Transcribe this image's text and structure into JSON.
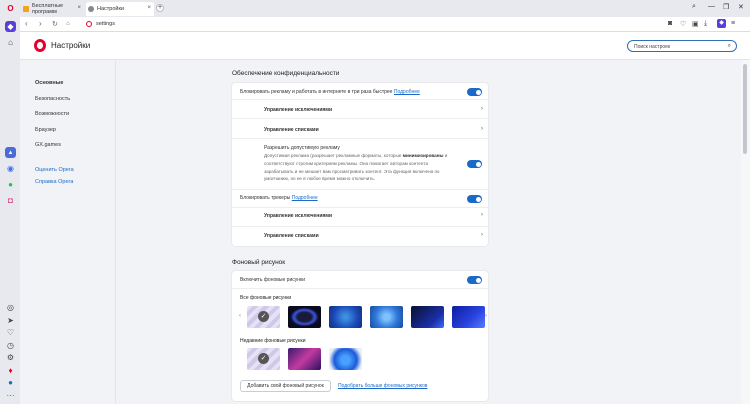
{
  "tabs": [
    {
      "label": "Бесплатные программ"
    },
    {
      "label": "Настройки"
    }
  ],
  "window": {
    "minimize": "—",
    "restore": "❐",
    "close": "✕"
  },
  "address": {
    "url": "settings"
  },
  "header": {
    "title": "Настройки",
    "search_placeholder": "Поиск настроек"
  },
  "leftnav": {
    "items": [
      "Основные",
      "Безопасность",
      "Возможности",
      "Браузер",
      "GX.games"
    ],
    "links": [
      "Оценить Opera",
      "Справка Opera"
    ]
  },
  "privacy": {
    "title": "Обеспечение конфиденциальности",
    "adblock_label": "Блокировать рекламу и работать в интернете в три раза быстрее",
    "more": "Подробнее",
    "exceptions": "Управление исключениями",
    "lists": "Управление списками",
    "acceptable_title": "Разрешить допустимую рекламу",
    "acceptable_desc_1": "Допустимая реклама (разрешает рекламные форматы, которые",
    "acceptable_bold": "минимизированы",
    "acceptable_desc_2": "и соответствуют строгим критериям рекламы. Она помогает авторам контента зарабатывать и не мешает вам просматривать контент. Эта функция включена по умолчанию, но ее в любое время можно отключить.",
    "trackers_label": "Блокировать трекеры",
    "trackers_more": "Подробнее",
    "exceptions2": "Управление исключениями",
    "lists2": "Управление списками"
  },
  "wallpaper": {
    "title": "Фоновый рисунок",
    "enable_label": "Включить фоновые рисунки",
    "all_label": "Все фоновые рисунки",
    "recent_label": "Недавние фоновые рисунки",
    "add_button": "Добавить свой фоновый рисунок",
    "more_link": "Подобрать больше фоновых рисунков"
  },
  "colors": {
    "accent": "#1b6ac9",
    "opera_red": "#e3002a"
  }
}
